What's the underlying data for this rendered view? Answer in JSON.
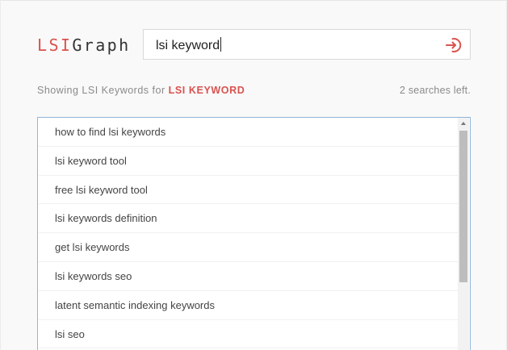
{
  "logo": {
    "part1": "LSI",
    "part2": "Graph"
  },
  "search": {
    "value": "lsi keyword",
    "placeholder": ""
  },
  "icons": {
    "submit": "sign-in-arrow-icon",
    "accent_color": "#d9534f"
  },
  "status": {
    "prefix": "Showing LSI Keywords for",
    "keyword": "LSI KEYWORD",
    "remaining": "2 searches left."
  },
  "results": [
    "how to find lsi keywords",
    "lsi keyword tool",
    "free lsi keyword tool",
    "lsi keywords definition",
    "get lsi keywords",
    "lsi keywords seo",
    "latent semantic indexing keywords",
    "lsi seo"
  ]
}
